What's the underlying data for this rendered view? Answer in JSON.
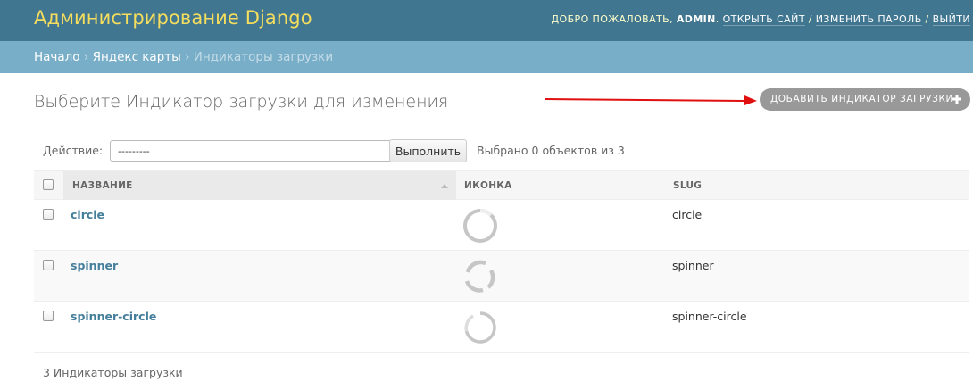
{
  "header": {
    "site_title": "Администрирование Django",
    "welcome": "ДОБРО ПОЖАЛОВАТЬ,",
    "username": "ADMIN",
    "view_site": "ОТКРЫТЬ САЙТ",
    "change_password": "ИЗМЕНИТЬ ПАРОЛЬ",
    "logout": "ВЫЙТИ",
    "separator": "/"
  },
  "breadcrumbs": {
    "home": "Начало",
    "app": "Яндекс карты",
    "current": "Индикаторы загрузки",
    "separator": "›"
  },
  "page": {
    "title": "Выберите Индикатор загрузки для изменения",
    "add_button": "ДОБАВИТЬ ИНДИКАТОР ЗАГРУЗКИ"
  },
  "actions": {
    "label": "Действие:",
    "selected_value": "---------",
    "go_button": "Выполнить",
    "counter": "Выбрано 0 объектов из 3"
  },
  "table": {
    "columns": [
      "НАЗВАНИЕ",
      "ИКОНКА",
      "SLUG"
    ],
    "rows": [
      {
        "name": "circle",
        "icon": "circle-loader-icon",
        "slug": "circle"
      },
      {
        "name": "spinner",
        "icon": "spinner-loader-icon",
        "slug": "spinner"
      },
      {
        "name": "spinner-circle",
        "icon": "spinner-circle-loader-icon",
        "slug": "spinner-circle"
      }
    ]
  },
  "footer": {
    "result_count": "3 Индикаторы загрузки"
  },
  "colors": {
    "header_bg": "#417690",
    "title_yellow": "#f5dd5d",
    "breadcrumb_bg": "#79aec8",
    "link": "#447e9b",
    "add_button_bg": "#999999",
    "annotation_arrow": "#e01010"
  }
}
